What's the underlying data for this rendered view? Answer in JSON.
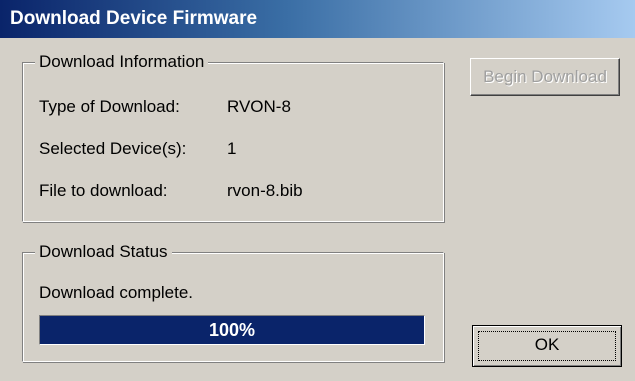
{
  "window": {
    "title": "Download Device Firmware"
  },
  "download_information": {
    "legend": "Download Information",
    "rows": [
      {
        "label": "Type of Download:",
        "value": "RVON-8"
      },
      {
        "label": "Selected Device(s):",
        "value": "1"
      },
      {
        "label": "File to download:",
        "value": "rvon-8.bib"
      }
    ]
  },
  "download_status": {
    "legend": "Download Status",
    "message": "Download complete.",
    "progress_label": "100%",
    "progress_fraction": 1.0
  },
  "buttons": {
    "begin_download": "Begin Download",
    "begin_download_enabled": false,
    "ok": "OK"
  },
  "colors": {
    "title_bar": "#0a246a",
    "progress_fill": "#0a246a",
    "dialog_background": "#d4d0c8"
  }
}
